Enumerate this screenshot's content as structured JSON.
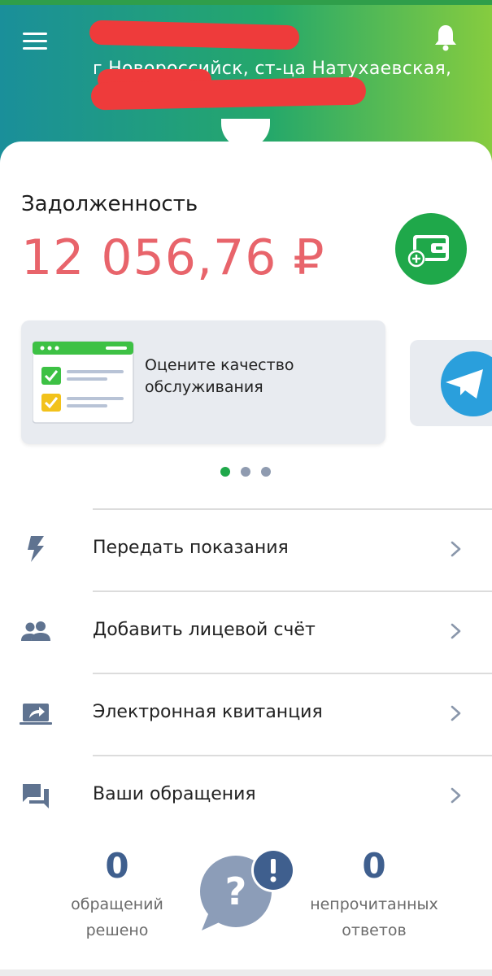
{
  "header": {
    "address_line": "г Новороссийск, ст-ца Натухаевская,"
  },
  "debt": {
    "label": "Задолженность",
    "amount": "12 056,76 ₽"
  },
  "banners": [
    {
      "text": "Оцените качество обслуживания"
    }
  ],
  "carousel": {
    "count": 3,
    "active": 0
  },
  "menu": [
    {
      "label": "Передать показания",
      "icon": "bolt-icon"
    },
    {
      "label": "Добавить лицевой счёт",
      "icon": "people-icon"
    },
    {
      "label": "Электронная квитанция",
      "icon": "share-screen-icon"
    },
    {
      "label": "Ваши обращения",
      "icon": "chat-icon"
    }
  ],
  "stats": {
    "resolved": {
      "value": "0",
      "label_line1": "обращений",
      "label_line2": "решено"
    },
    "unread": {
      "value": "0",
      "label_line1": "непрочитанных",
      "label_line2": "ответов"
    }
  },
  "colors": {
    "accent_green": "#1fa84a",
    "debt_red": "#e8646b",
    "stat_blue": "#3f5f8e",
    "icon_grey": "#5f7390"
  }
}
